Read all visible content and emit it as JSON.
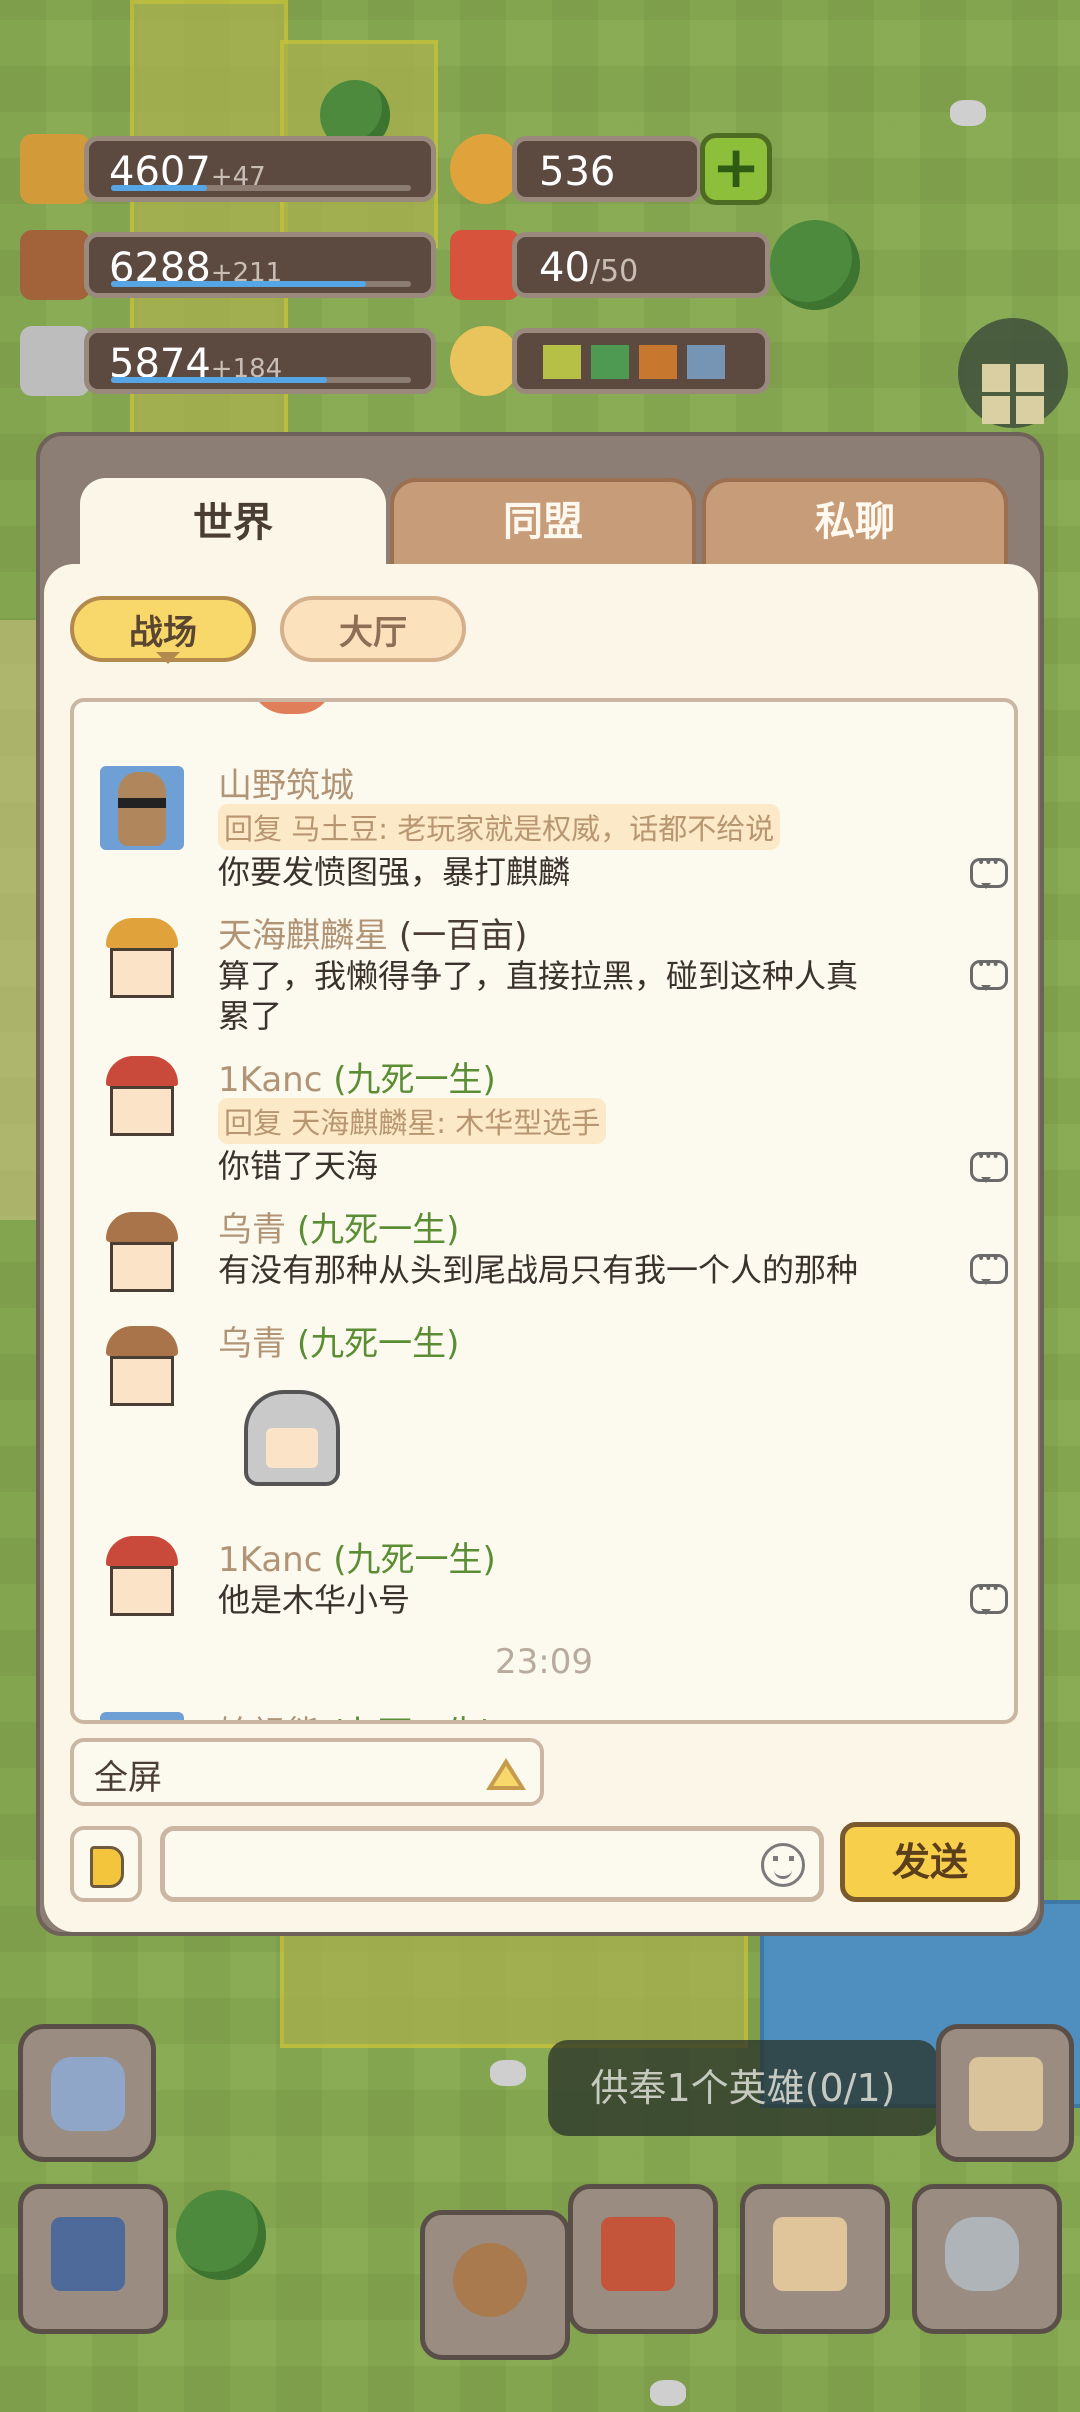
{
  "resources": [
    {
      "name": "grain",
      "value": "4607",
      "delta": "+47",
      "fill": 0.32,
      "color": "#d39a3a"
    },
    {
      "name": "wood",
      "value": "6288",
      "delta": "+211",
      "fill": 0.85,
      "color": "#a2623a"
    },
    {
      "name": "stone",
      "value": "5874",
      "delta": "+184",
      "fill": 0.72,
      "color": "#bdbdbd"
    }
  ],
  "coins": {
    "value": "536"
  },
  "gifts": {
    "value": "40",
    "max": "/50"
  },
  "weather_swatches": [
    "#b6c046",
    "#4f9a52",
    "#c8772f",
    "#7695b5"
  ],
  "chat": {
    "tabs": {
      "world": "世界",
      "alliance": "同盟",
      "private": "私聊"
    },
    "subtabs": {
      "battlefield": "战场",
      "hall": "大厅"
    },
    "messages": [
      {
        "name": "山野筑城",
        "title": "",
        "reply": "回复 马土豆: 老玩家就是权威，话都不给说",
        "text": "你要发愤图强，暴打麒麟"
      },
      {
        "name": "天海麒麟星",
        "title": "(一百亩)",
        "text": "算了，我懒得争了，直接拉黑，碰到这种人真",
        "text2": "累了"
      },
      {
        "name": "1Kanc",
        "title": "(九死一生)",
        "reply": "回复 天海麒麟星: 木华型选手",
        "text": "你错了天海"
      },
      {
        "name": "乌青",
        "title": "(九死一生)",
        "text": "有没有那种从头到尾战局只有我一个人的那种"
      },
      {
        "name": "乌青",
        "title": "(九死一生)",
        "sticker": "knight-helmet"
      },
      {
        "name": "1Kanc",
        "title": "(九死一生)",
        "text": "他是木华小号"
      }
    ],
    "time": "23:09",
    "partial_name": "始祖熊",
    "partial_title": "(九死一生)",
    "fullscreen_label": "全屏",
    "send_label": "发送",
    "input_value": ""
  },
  "quest": {
    "text": "供奉1个英雄(0/1)"
  }
}
